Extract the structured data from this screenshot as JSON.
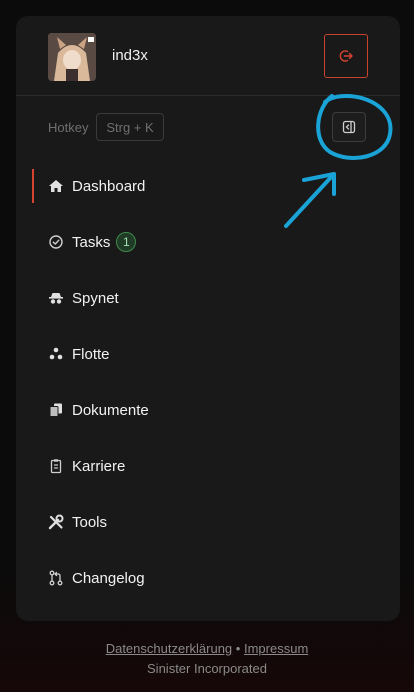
{
  "user": {
    "name": "ind3x"
  },
  "hotkey": {
    "label": "Hotkey",
    "key": "Strg + K"
  },
  "nav": {
    "items": [
      {
        "label": "Dashboard",
        "icon": "home-icon",
        "active": true
      },
      {
        "label": "Tasks",
        "icon": "check-circle-icon",
        "badge": "1"
      },
      {
        "label": "Spynet",
        "icon": "spy-icon"
      },
      {
        "label": "Flotte",
        "icon": "ships-icon"
      },
      {
        "label": "Dokumente",
        "icon": "documents-icon"
      },
      {
        "label": "Karriere",
        "icon": "clipboard-icon"
      },
      {
        "label": "Tools",
        "icon": "tools-icon"
      },
      {
        "label": "Changelog",
        "icon": "git-branch-icon"
      }
    ]
  },
  "footer": {
    "privacy": "Datenschutzerklärung",
    "separator": "•",
    "imprint": "Impressum",
    "company": "Sinister Incorporated"
  },
  "colors": {
    "accent": "#d6442f",
    "badge_green": "#3f8a4e",
    "annotation": "#1aa3d6"
  }
}
